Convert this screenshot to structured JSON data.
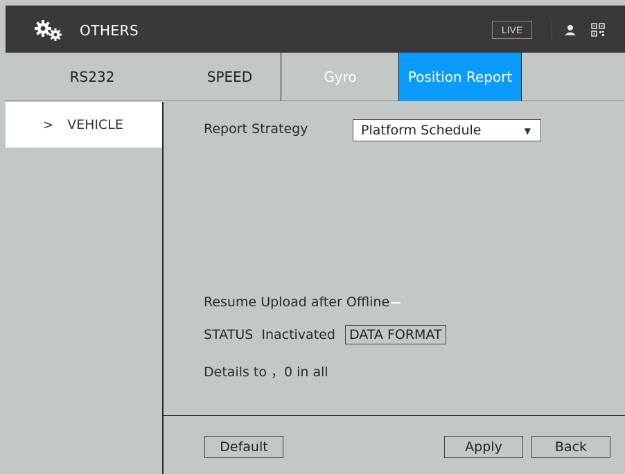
{
  "header": {
    "title": "OTHERS",
    "live_label": "LIVE",
    "logo_icon": "gears-icon",
    "user_icon": "user-icon",
    "qr_icon": "qr-code-icon"
  },
  "tabs": [
    {
      "label": "RS232"
    },
    {
      "label": "SPEED"
    },
    {
      "label": "Gyro"
    },
    {
      "label": "Position Report",
      "active": true
    }
  ],
  "sidebar": {
    "items": [
      {
        "chevron": ">",
        "label": "VEHICLE",
        "selected": true
      }
    ]
  },
  "form": {
    "report_strategy_label": "Report Strategy",
    "report_strategy_value": "Platform Schedule",
    "resume_upload_label": "Resume Upload after Offline",
    "status_label": "STATUS",
    "status_value": "Inactivated",
    "data_format_button": "DATA FORMAT",
    "details_text": "Details  to ，0 in all"
  },
  "footer": {
    "default_label": "Default",
    "apply_label": "Apply",
    "back_label": "Back"
  },
  "colors": {
    "accent": "#0a9bff",
    "header_bg": "#3a3838",
    "panel_bg": "#c1c8c6"
  }
}
